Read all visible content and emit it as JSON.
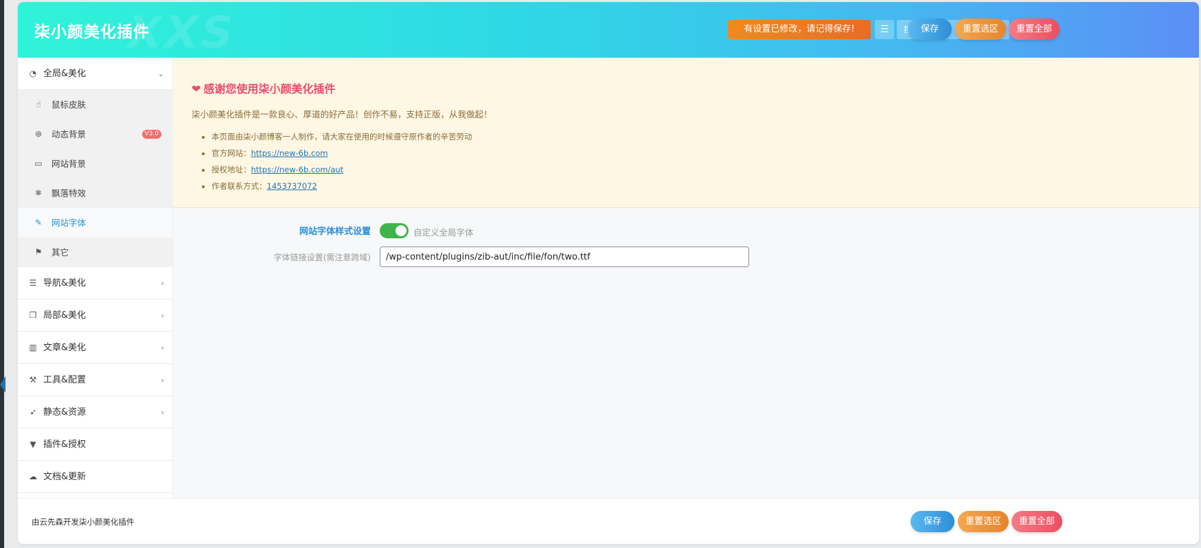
{
  "header": {
    "title": "柒小颜美化插件",
    "watermark": "XXS",
    "notice": "有设置已修改，请记得保存!",
    "search_placeholder": "搜索...",
    "save_label": "保存",
    "reset_section_label": "重置选区",
    "reset_all_label": "重置全部"
  },
  "sidebar": {
    "groups": [
      {
        "label": "全局&美化",
        "icon": "dashboard-icon",
        "expanded": true
      },
      {
        "label": "导航&美化",
        "icon": "list-icon"
      },
      {
        "label": "局部&美化",
        "icon": "copy-icon"
      },
      {
        "label": "文章&美化",
        "icon": "map-icon"
      },
      {
        "label": "工具&配置",
        "icon": "wrench-icon"
      },
      {
        "label": "静态&资源",
        "icon": "rocket-icon"
      },
      {
        "label": "插件&授权",
        "icon": "vuejs-icon"
      },
      {
        "label": "文档&更新",
        "icon": "cloud-download-icon"
      }
    ],
    "sub_items": [
      {
        "label": "鼠标皮肤",
        "icon": "hand-pointer-icon"
      },
      {
        "label": "动态背景",
        "icon": "life-ring-icon",
        "badge": "V3.0"
      },
      {
        "label": "网站背景",
        "icon": "desktop-icon"
      },
      {
        "label": "飘落特效",
        "icon": "snowflake-icon"
      },
      {
        "label": "网站字体",
        "icon": "pencil-icon",
        "active": true
      },
      {
        "label": "其它",
        "icon": "flag-icon"
      }
    ]
  },
  "notice": {
    "title": "感谢您使用柒小颜美化插件",
    "intro": "柒小颜美化插件是一款良心、厚道的好产品！创作不易，支持正版，从我做起！",
    "items": [
      {
        "text": "本页面由柒小颜博客一人制作，请大家在使用的时候遵守原作者的辛苦劳动",
        "link": ""
      },
      {
        "text": "官方网站：",
        "link": "https://new-6b.com"
      },
      {
        "text": "授权地址：",
        "link": "https://new-6b.com/aut"
      },
      {
        "text": "作者联系方式：",
        "link": "1453737072"
      }
    ]
  },
  "fields": {
    "font_style_label": "网站字体样式设置",
    "font_style_toggle_text": "自定义全局字体",
    "font_style_enabled": true,
    "font_link_label": "字体链接设置(需注意跨域)",
    "font_link_value": "/wp-content/plugins/zib-aut/inc/file/fon/two.ttf"
  },
  "footer": {
    "credit": "由云先森开发柒小颜美化插件",
    "save_label": "保存",
    "reset_section_label": "重置选区",
    "reset_all_label": "重置全部"
  },
  "colors": {
    "accent": "#2b8fdc",
    "notice_title": "#ec4b6f",
    "toggle_on": "#3fb44a",
    "header_start": "#2ff3d8",
    "header_end": "#5b8ff5"
  }
}
